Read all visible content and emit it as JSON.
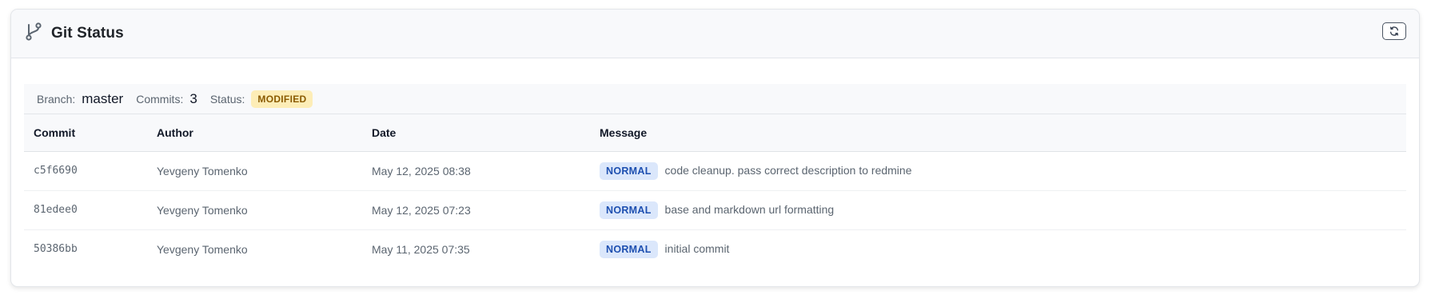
{
  "header": {
    "title": "Git Status",
    "icon": "git-branch-icon",
    "refresh_icon": "refresh-icon"
  },
  "summary": {
    "branch_label": "Branch:",
    "branch_value": "master",
    "commits_label": "Commits:",
    "commits_value": "3",
    "status_label": "Status:",
    "status_value": "MODIFIED"
  },
  "table": {
    "columns": [
      "Commit",
      "Author",
      "Date",
      "Message"
    ],
    "rows": [
      {
        "commit": "c5f6690",
        "author": "Yevgeny Tomenko",
        "date": "May 12, 2025 08:38",
        "tag": "NORMAL",
        "message": "code cleanup. pass correct description to redmine"
      },
      {
        "commit": "81edee0",
        "author": "Yevgeny Tomenko",
        "date": "May 12, 2025 07:23",
        "tag": "NORMAL",
        "message": "base and markdown url formatting"
      },
      {
        "commit": "50386bb",
        "author": "Yevgeny Tomenko",
        "date": "May 11, 2025 07:35",
        "tag": "NORMAL",
        "message": "initial commit"
      }
    ]
  },
  "colors": {
    "status_badge_bg": "#fdedb7",
    "status_badge_fg": "#8a5a00",
    "tag_bg": "#dbe7fb",
    "tag_fg": "#1d4fb0"
  }
}
